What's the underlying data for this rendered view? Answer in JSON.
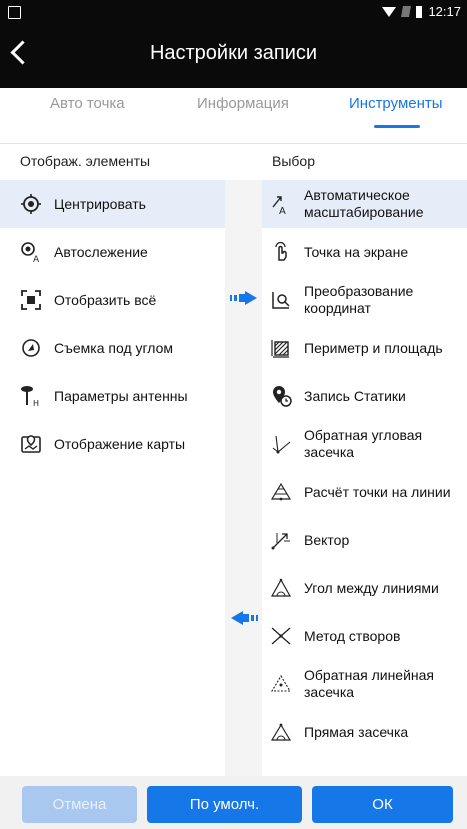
{
  "status": {
    "time": "12:17"
  },
  "appbar": {
    "title": "Настройки записи"
  },
  "tabs": [
    {
      "label": "Авто точка"
    },
    {
      "label": "Информация"
    },
    {
      "label": "Инструменты"
    }
  ],
  "left": {
    "header": "Отображ. элементы",
    "items": [
      {
        "label": "Центрировать"
      },
      {
        "label": "Автослежение"
      },
      {
        "label": "Отобразить всё"
      },
      {
        "label": "Съемка под углом"
      },
      {
        "label": "Параметры антенны"
      },
      {
        "label": "Отображение карты"
      }
    ]
  },
  "right": {
    "header": "Выбор",
    "items": [
      {
        "label": "Автоматическое масштабирование"
      },
      {
        "label": "Точка на экране"
      },
      {
        "label": "Преобразование координат"
      },
      {
        "label": "Периметр и площадь"
      },
      {
        "label": "Запись Статики"
      },
      {
        "label": "Обратная угловая засечка"
      },
      {
        "label": "Расчёт точки на линии"
      },
      {
        "label": "Вектор"
      },
      {
        "label": "Угол между линиями"
      },
      {
        "label": "Метод створов"
      },
      {
        "label": "Обратная линейная засечка"
      },
      {
        "label": "Прямая засечка"
      }
    ]
  },
  "buttons": {
    "cancel": "Отмена",
    "default": "По умолч.",
    "ok": "ОК"
  },
  "colors": {
    "accent": "#1677e8",
    "selected_bg": "#e6ecf8"
  }
}
